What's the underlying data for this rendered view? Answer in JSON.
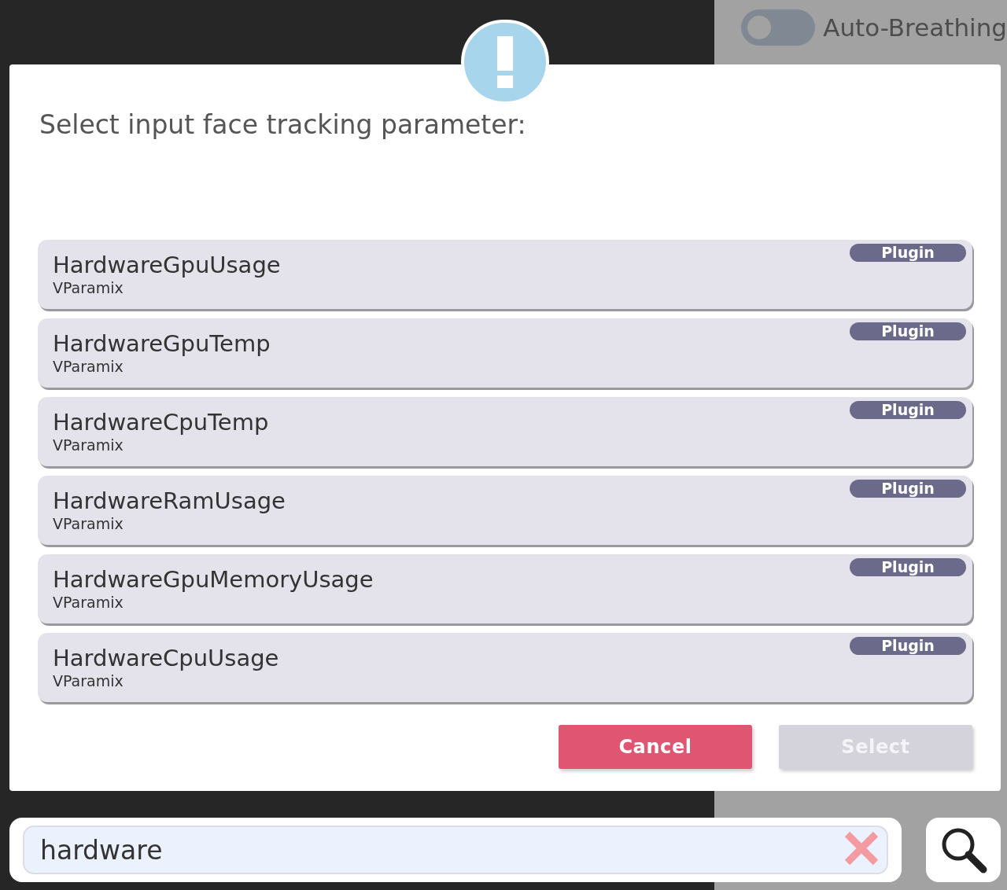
{
  "side_panel": {
    "toggle": {
      "label": "Auto-Breathing",
      "on": false
    }
  },
  "dialog": {
    "title": "Select input face tracking parameter:",
    "items": [
      {
        "name": "HardwareGpuUsage",
        "source": "VParamix",
        "badge": "Plugin"
      },
      {
        "name": "HardwareGpuTemp",
        "source": "VParamix",
        "badge": "Plugin"
      },
      {
        "name": "HardwareCpuTemp",
        "source": "VParamix",
        "badge": "Plugin"
      },
      {
        "name": "HardwareRamUsage",
        "source": "VParamix",
        "badge": "Plugin"
      },
      {
        "name": "HardwareGpuMemoryUsage",
        "source": "VParamix",
        "badge": "Plugin"
      },
      {
        "name": "HardwareCpuUsage",
        "source": "VParamix",
        "badge": "Plugin"
      }
    ],
    "buttons": [
      {
        "label": "Cancel",
        "kind": "cancel",
        "disabled": false
      },
      {
        "label": "Select",
        "kind": "primary",
        "disabled": true
      }
    ]
  },
  "search": {
    "value": "hardware"
  }
}
